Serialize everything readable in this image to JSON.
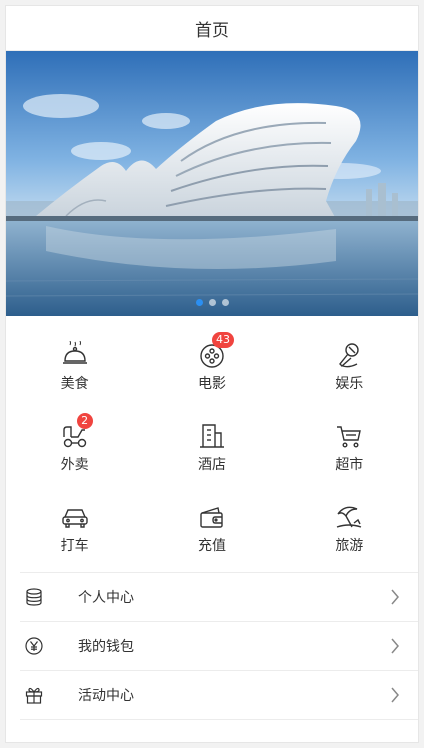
{
  "nav": {
    "title": "首页"
  },
  "banner": {
    "active_index": 0,
    "dot_count": 3
  },
  "grid": [
    {
      "label": "美食",
      "icon": "dining-cloche-icon",
      "badge": null
    },
    {
      "label": "电影",
      "icon": "film-reel-icon",
      "badge": "43"
    },
    {
      "label": "娱乐",
      "icon": "microphone-icon",
      "badge": null
    },
    {
      "label": "外卖",
      "icon": "scooter-icon",
      "badge": "2"
    },
    {
      "label": "酒店",
      "icon": "building-icon",
      "badge": null
    },
    {
      "label": "超市",
      "icon": "shopping-cart-icon",
      "badge": null
    },
    {
      "label": "打车",
      "icon": "car-icon",
      "badge": null
    },
    {
      "label": "充值",
      "icon": "wallet-icon",
      "badge": null
    },
    {
      "label": "旅游",
      "icon": "beach-umbrella-icon",
      "badge": null
    }
  ],
  "list": [
    {
      "label": "个人中心",
      "icon": "database-icon"
    },
    {
      "label": "我的钱包",
      "icon": "yen-coin-icon"
    },
    {
      "label": "活动中心",
      "icon": "gift-icon"
    }
  ],
  "colors": {
    "badge": "#f0443f",
    "dot_active": "#2b8ff2",
    "text": "#333333"
  }
}
